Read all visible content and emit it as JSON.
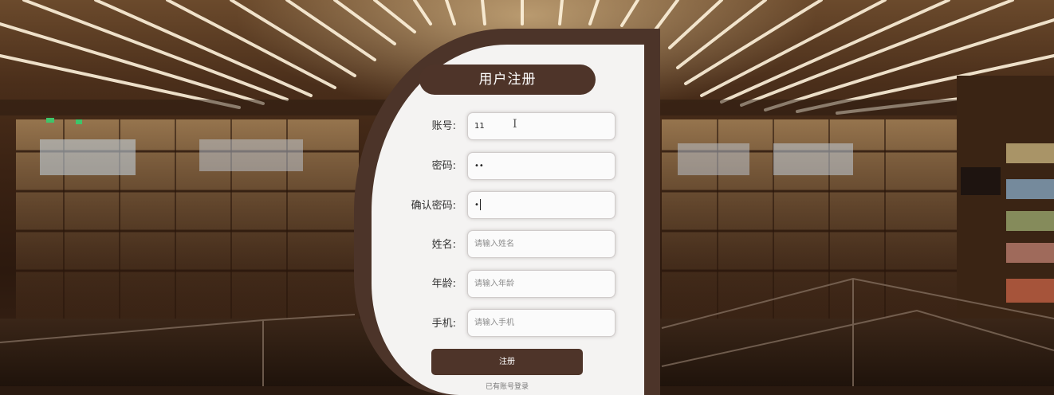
{
  "form": {
    "title": "用户注册",
    "fields": [
      {
        "label": "账号:",
        "value": "11",
        "placeholder": ""
      },
      {
        "label": "密码:",
        "value": "••",
        "placeholder": ""
      },
      {
        "label": "确认密码:",
        "value": "•",
        "placeholder": ""
      },
      {
        "label": "姓名:",
        "value": "",
        "placeholder": "请输入姓名"
      },
      {
        "label": "年龄:",
        "value": "",
        "placeholder": "请输入年龄"
      },
      {
        "label": "手机:",
        "value": "",
        "placeholder": "请输入手机"
      }
    ],
    "submit_label": "注册",
    "login_link": "已有账号登录"
  },
  "colors": {
    "accent": "#4e3429",
    "card": "#f4f3f2"
  },
  "icons": {
    "text_cursor": "text-cursor-icon"
  }
}
